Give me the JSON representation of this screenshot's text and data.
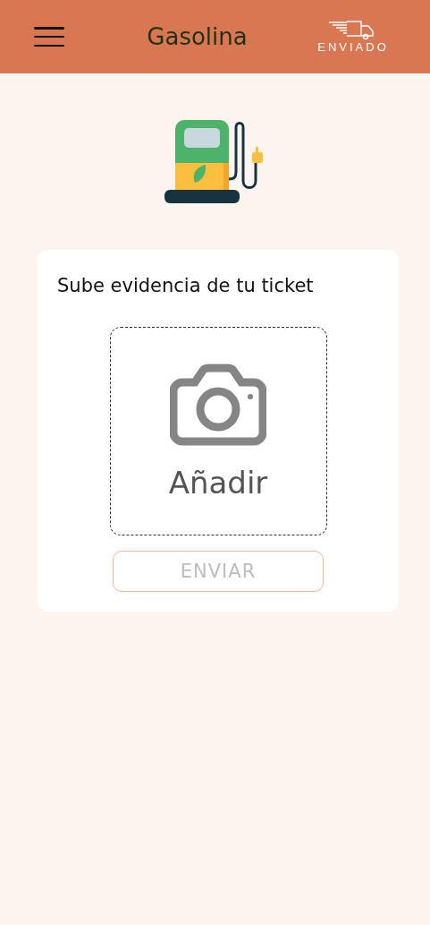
{
  "header": {
    "title": "Gasolina",
    "logo_text": "ENVIADO"
  },
  "card": {
    "title": "Sube evidencia de tu ticket",
    "upload_label": "Añadir",
    "submit": {
      "label": "ENVIAR",
      "disabled": true
    }
  }
}
